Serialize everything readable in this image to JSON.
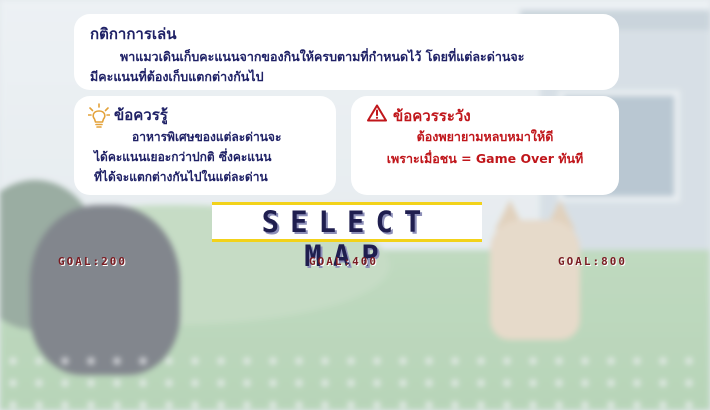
{
  "rules": {
    "title": "กติกาการเล่น",
    "line1": "พาแมวเดินเก็บคะแนนจากของกินให้ครบตามที่กำหนดไว้ โดยที่แต่ละด่านจะ",
    "line2": "มีคะแนนที่ต้องเก็บแตกต่างกันไป"
  },
  "tips": {
    "icon": "lightbulb-icon",
    "title": "ข้อควรรู้",
    "line1": "อาหารพิเศษของแต่ละด่านจะ",
    "line2": "ได้คะแนนเยอะกว่าปกติ ซึ่งคะแนน",
    "line3": "ที่ได้จะแตกต่างกันไปในแต่ละด่าน"
  },
  "warning": {
    "icon": "warning-triangle-icon",
    "title": "ข้อควรระวัง",
    "line1": "ต้องพยายามหลบหมาให้ดี",
    "line2": "เพราะเมื่อชน = Game Over ทันที"
  },
  "select_map": {
    "label": "SELECT MAP"
  },
  "maps": [
    {
      "goal": "GOAL:200"
    },
    {
      "goal": "GOAL:400"
    },
    {
      "goal": "GOAL:800"
    }
  ],
  "colors": {
    "navy_text": "#1f2166",
    "warning_red": "#c0161b",
    "accent_yellow": "#f2d21a",
    "goal_red": "#7a1c22"
  }
}
